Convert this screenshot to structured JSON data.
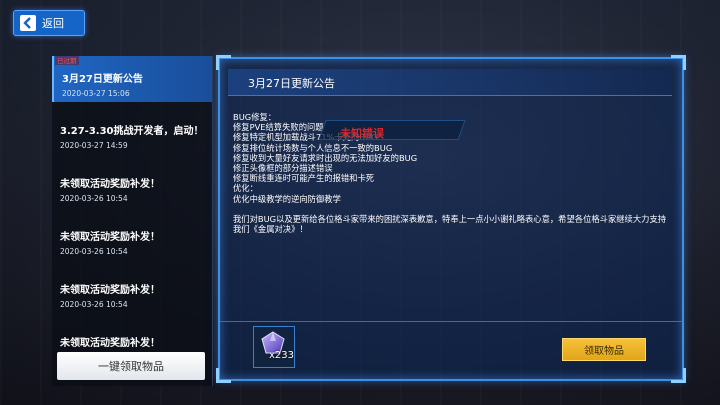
{
  "nav": {
    "back_label": "返回"
  },
  "list": {
    "items": [
      {
        "tag": "已过期",
        "title": "3月27日更新公告",
        "date": "2020-03-27 15:06",
        "active": true
      },
      {
        "title": "3.27-3.30挑战开发者，启动！",
        "date": "2020-03-27 14:59"
      },
      {
        "title": "未领取活动奖励补发！",
        "date": "2020-03-26 10:54"
      },
      {
        "title": "未领取活动奖励补发！",
        "date": "2020-03-26 10:54"
      },
      {
        "title": "未领取活动奖励补发！",
        "date": "2020-03-26 10:54"
      },
      {
        "title": "未领取活动奖励补发！"
      }
    ],
    "claim_all_label": "一键领取物品"
  },
  "content": {
    "title": "3月27日更新公告",
    "overlay_text": "未知错误",
    "lines": [
      "BUG修复：",
      "修复PVE结算失败的问题",
      "修复特定机型加载战斗71%卡死的BUG",
      "修复排位统计场数与个人信息不一致的BUG",
      "修复收到大量好友请求时出现的无法加好友的BUG",
      "修正头像框的部分描述错误",
      "修复断线重连时可能产生的报错和卡死",
      "优化：",
      "优化中级教学的逆向防御教学"
    ],
    "paragraph": "我们对BUG以及更新给各位格斗家带来的困扰深表歉意，特奉上一点小小谢礼略表心意，希望各位格斗家继续大力支持我们《金属对决》！",
    "reward": {
      "icon": "gem-icon",
      "quantity": "x233"
    },
    "claim_label": "领取物品"
  },
  "colors": {
    "accent_blue": "#1f66c4",
    "claim_gold": "#f7c13a",
    "expired_red": "#ff4b4b",
    "error_red": "#d8282f"
  }
}
